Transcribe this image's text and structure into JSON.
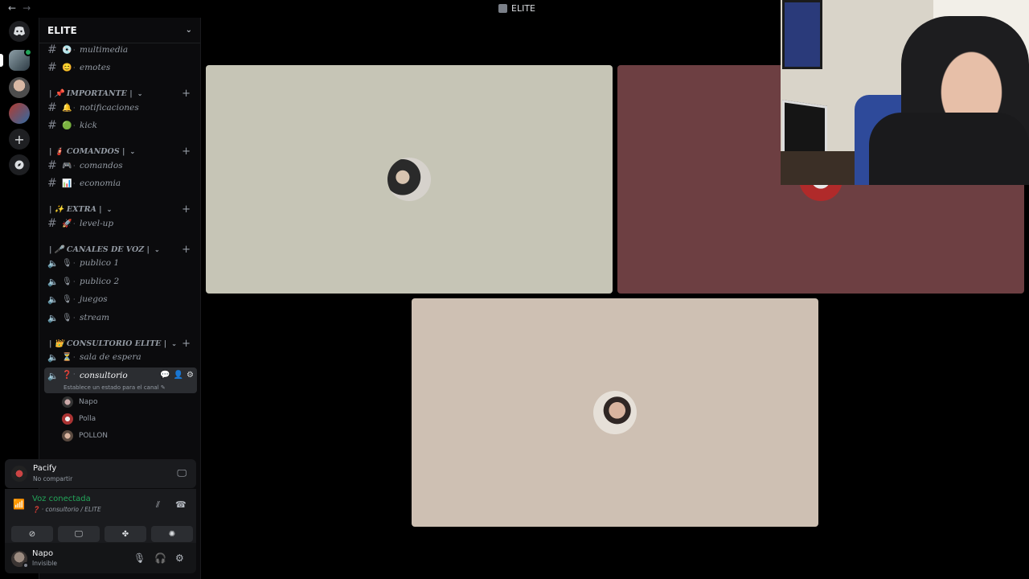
{
  "titlebar": {
    "back": "←",
    "forward": "→",
    "title": "ELITE"
  },
  "rail": {
    "home_icon": "discord-icon",
    "add_icon": "+",
    "explore_icon": "⌀"
  },
  "server": {
    "name": "ELITE",
    "chevron": "⌄"
  },
  "channels": {
    "multimedia": {
      "emoji": "💿",
      "name": "multimedia"
    },
    "emotes": {
      "emoji": "😊",
      "name": "emotes"
    },
    "cat_importante": {
      "label": "| 📌 IMPORTANTE |"
    },
    "notificaciones": {
      "emoji": "🔔",
      "name": "notificaciones"
    },
    "kick": {
      "emoji": "🟢",
      "name": "kick"
    },
    "cat_comandos": {
      "label": "| 🧯 COMANDOS |"
    },
    "comandos": {
      "emoji": "🎮",
      "name": "comandos"
    },
    "economia": {
      "emoji": "📊",
      "name": "economia"
    },
    "cat_extra": {
      "label": "| ✨ EXTRA |"
    },
    "levelup": {
      "emoji": "🚀",
      "name": "level-up"
    },
    "cat_voz": {
      "label": "| 🎤 CANALES DE VOZ |"
    },
    "publico1": {
      "emoji": "🎙",
      "name": "publico 1"
    },
    "publico2": {
      "emoji": "🎙",
      "name": "publico 2"
    },
    "juegos": {
      "emoji": "🎙",
      "name": "juegos"
    },
    "stream": {
      "emoji": "🎙",
      "name": "stream"
    },
    "cat_consultorio": {
      "label": "| 👑 CONSULTORIO ELITE |"
    },
    "sala": {
      "emoji": "⏳",
      "name": "sala de espera"
    },
    "consultorio": {
      "emoji": "❓",
      "name": "consultorio",
      "status": "Establece un estado para el canal ✎"
    }
  },
  "voice_users": [
    "Napo",
    "Polla",
    "POLLON"
  ],
  "activity": {
    "name": "Pacify",
    "sub": "No compartir"
  },
  "voice": {
    "title": "Voz conectada",
    "sub": "❓ · consultorio / ELITE"
  },
  "user": {
    "name": "Napo",
    "status": "Invisible"
  },
  "colors": {
    "accent_green": "#23a55a",
    "tile1": "#c6c5b6",
    "tile2": "#6d3f42",
    "tile3": "#cec0b3"
  }
}
